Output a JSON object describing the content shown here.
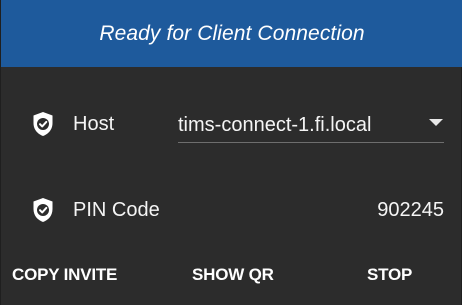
{
  "banner": {
    "status_text": "Ready for Client Connection"
  },
  "host": {
    "label": "Host",
    "icon": "shield-check-icon",
    "selected_value": "tims-connect-1.fi.local"
  },
  "pin": {
    "label": "PIN Code",
    "icon": "shield-check-icon",
    "value": "902245"
  },
  "actions": {
    "copy_invite": "COPY INVITE",
    "show_qr": "SHOW QR",
    "stop": "STOP"
  },
  "colors": {
    "banner_bg": "#1e5a9c",
    "panel_bg": "#2c2c2c",
    "text": "#f5f5f5"
  }
}
